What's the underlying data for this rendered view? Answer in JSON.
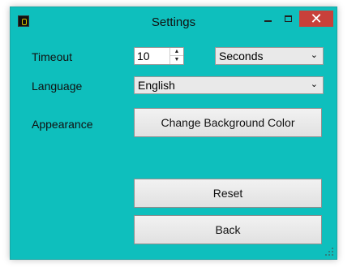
{
  "window": {
    "title": "Settings"
  },
  "title_controls": {
    "minimize": "—",
    "maximize": "□",
    "close": "✕"
  },
  "form": {
    "timeout": {
      "label": "Timeout",
      "value": "10",
      "units_selected": "Seconds"
    },
    "language": {
      "label": "Language",
      "selected": "English"
    },
    "appearance": {
      "label": "Appearance",
      "button": "Change Background Color"
    }
  },
  "actions": {
    "reset": "Reset",
    "back": "Back"
  },
  "icons": {
    "app": "app-icon",
    "spin_up": "chevron-up-icon",
    "spin_down": "chevron-down-icon",
    "dropdown": "chevron-down-icon",
    "resize": "resize-grip-icon"
  },
  "colors": {
    "window_bg": "#0ebfbd",
    "close_button": "#c8403a"
  }
}
